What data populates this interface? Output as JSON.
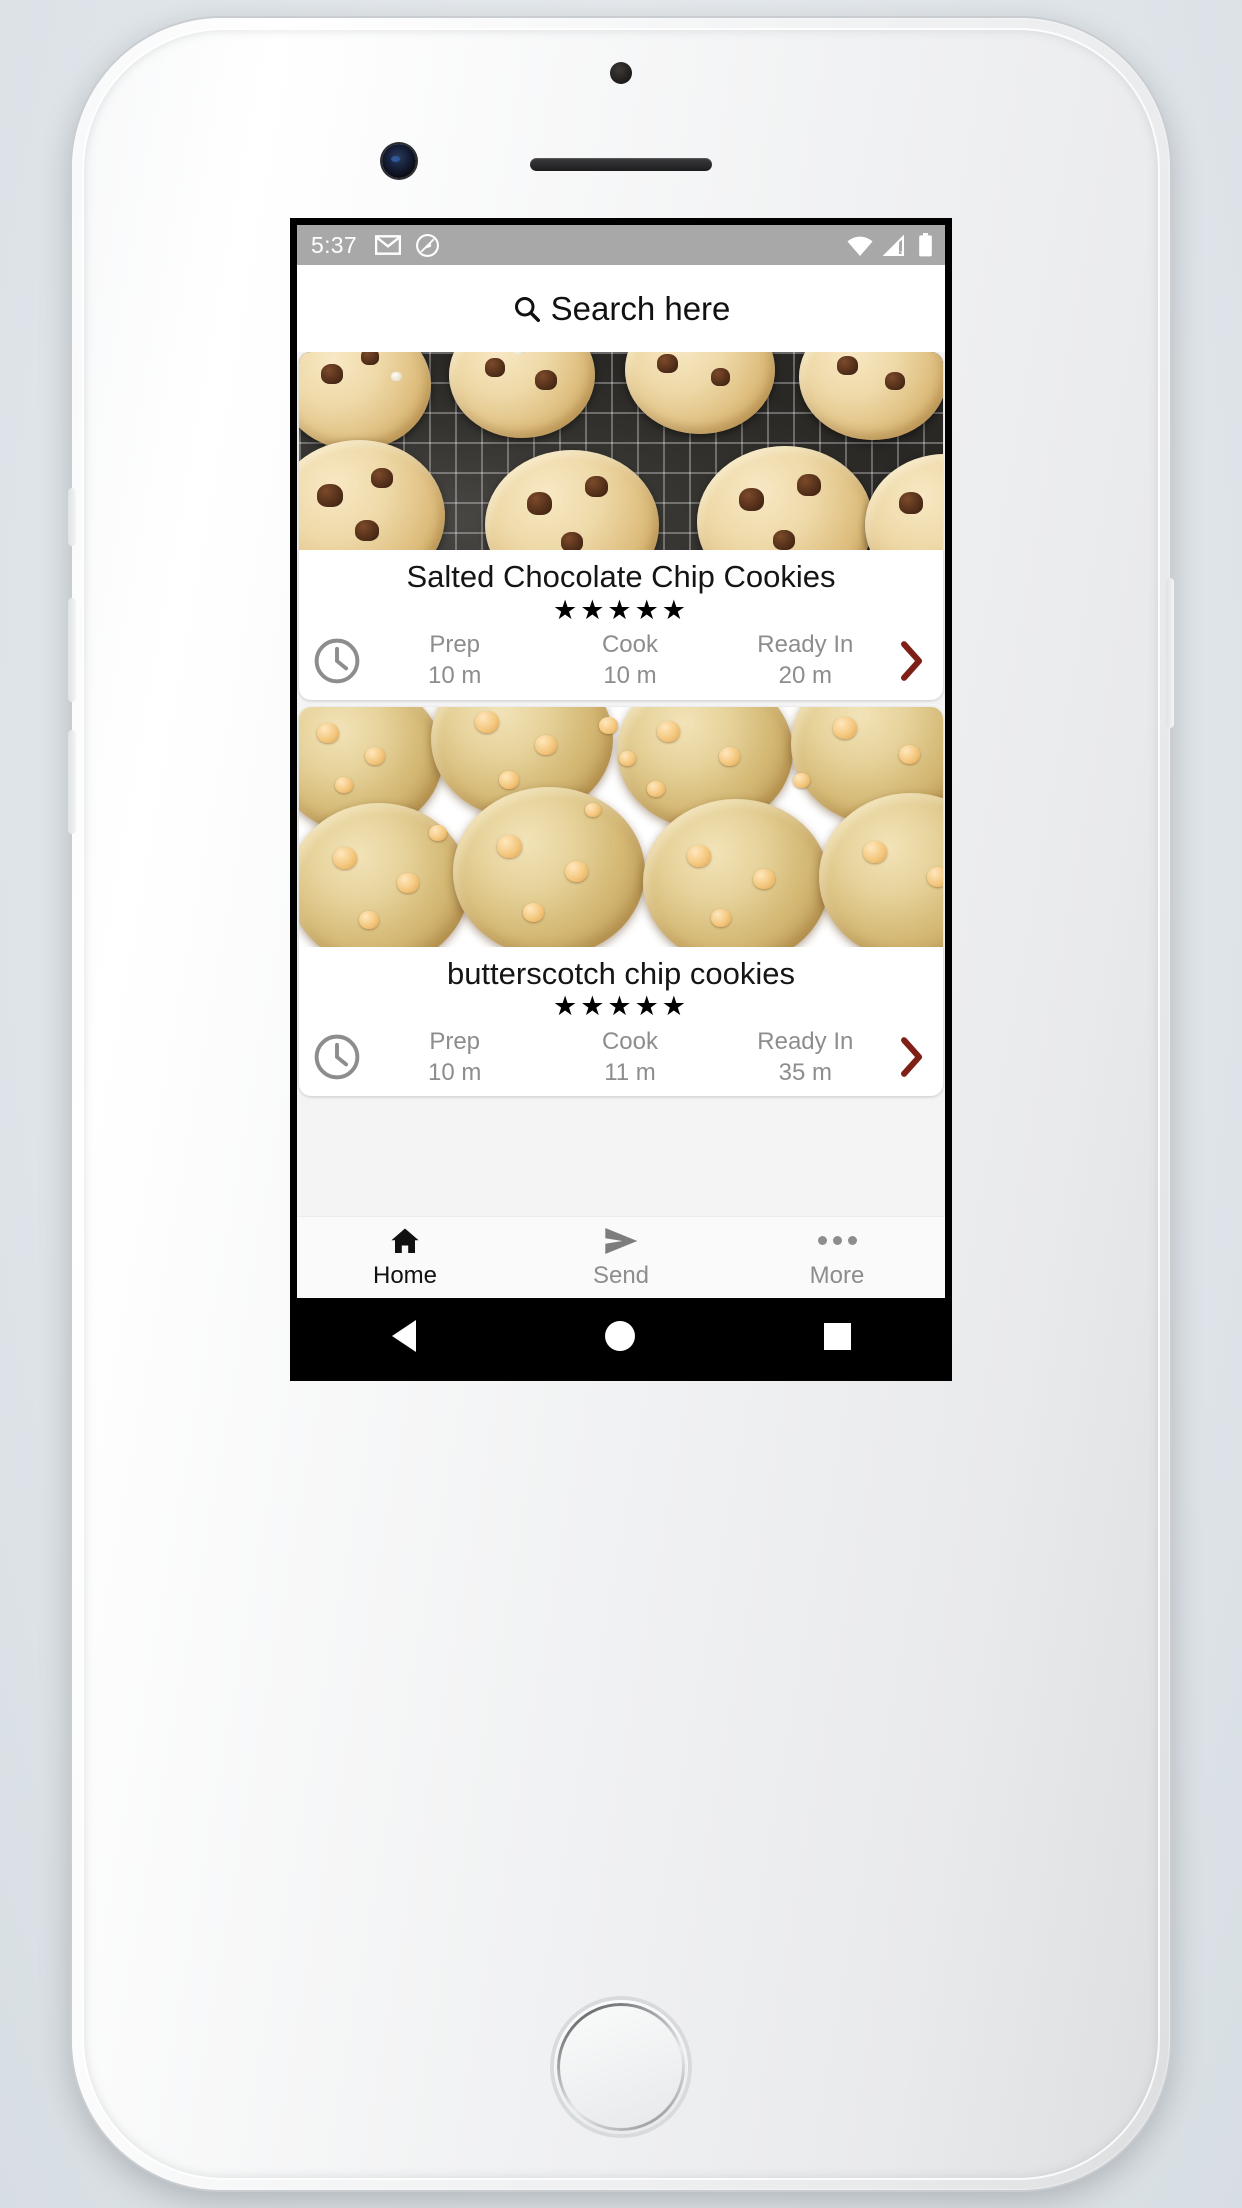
{
  "status_bar": {
    "time": "5:37",
    "left_icons": [
      "gmail-icon",
      "screenshot-capture-icon"
    ],
    "right_icons": [
      "wifi-icon",
      "cellular-no-sim-icon",
      "battery-icon"
    ],
    "background_color": "#a8a8a8"
  },
  "search": {
    "placeholder": "Search here",
    "icon": "search-icon"
  },
  "recipes": [
    {
      "title": "Salted Chocolate Chip Cookies",
      "rating_stars": "★★★★★",
      "rating_value": 5,
      "image_alt": "chocolate-chip-cookies-on-cooling-rack",
      "clock_icon": "clock-icon",
      "chevron_icon": "chevron-right-icon",
      "times": [
        {
          "label": "Prep",
          "value": "10 m"
        },
        {
          "label": "Cook",
          "value": "10 m"
        },
        {
          "label": "Ready In",
          "value": "20 m"
        }
      ]
    },
    {
      "title": "butterscotch chip cookies",
      "rating_stars": "★★★★★",
      "rating_value": 5,
      "image_alt": "butterscotch-chip-cookies-on-plate",
      "clock_icon": "clock-icon",
      "chevron_icon": "chevron-right-icon",
      "times": [
        {
          "label": "Prep",
          "value": "10 m"
        },
        {
          "label": "Cook",
          "value": "11 m"
        },
        {
          "label": "Ready In",
          "value": "35 m"
        }
      ]
    }
  ],
  "tabbar": {
    "items": [
      {
        "label": "Home",
        "icon": "home-icon",
        "active": true
      },
      {
        "label": "Send",
        "icon": "send-icon",
        "active": false
      },
      {
        "label": "More",
        "icon": "overflow-dots-icon",
        "active": false
      }
    ]
  },
  "android_nav": {
    "back": "back-triangle-icon",
    "home": "home-circle-icon",
    "recents": "recents-square-icon"
  },
  "colors": {
    "accent_chevron": "#7e1f18",
    "muted_text": "#8d8d8d",
    "status_bar": "#a8a8a8",
    "card_bg": "#ffffff",
    "list_bg": "#f4f4f4"
  }
}
